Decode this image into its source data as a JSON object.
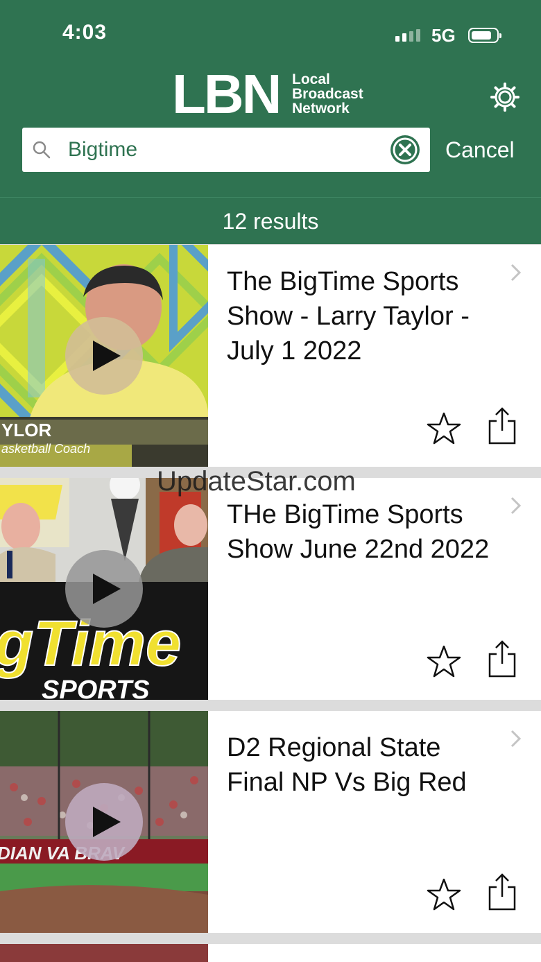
{
  "status_bar": {
    "time": "4:03",
    "network": "5G"
  },
  "header": {
    "logo_big": "LBN",
    "logo_small": [
      "Local",
      "Broadcast",
      "Network"
    ]
  },
  "search": {
    "value": "Bigtime",
    "cancel_label": "Cancel"
  },
  "results_label": "12 results",
  "results": [
    {
      "title": "The BigTime Sports Show - Larry Taylor - July 1 2022",
      "thumb_lower_text": "YLOR",
      "thumb_caption": "asketball Coach"
    },
    {
      "title": "THe BigTime Sports Show June 22nd 2022",
      "thumb_banner": "gTime",
      "thumb_sub": "SPORTS"
    },
    {
      "title": "D2 Regional State Final NP Vs Big Red",
      "thumb_banner": "DIAN VA    BRAV"
    }
  ],
  "watermark": "UpdateStar.com",
  "colors": {
    "brand_green": "#2f7351",
    "separator": "#dcdcdc"
  }
}
